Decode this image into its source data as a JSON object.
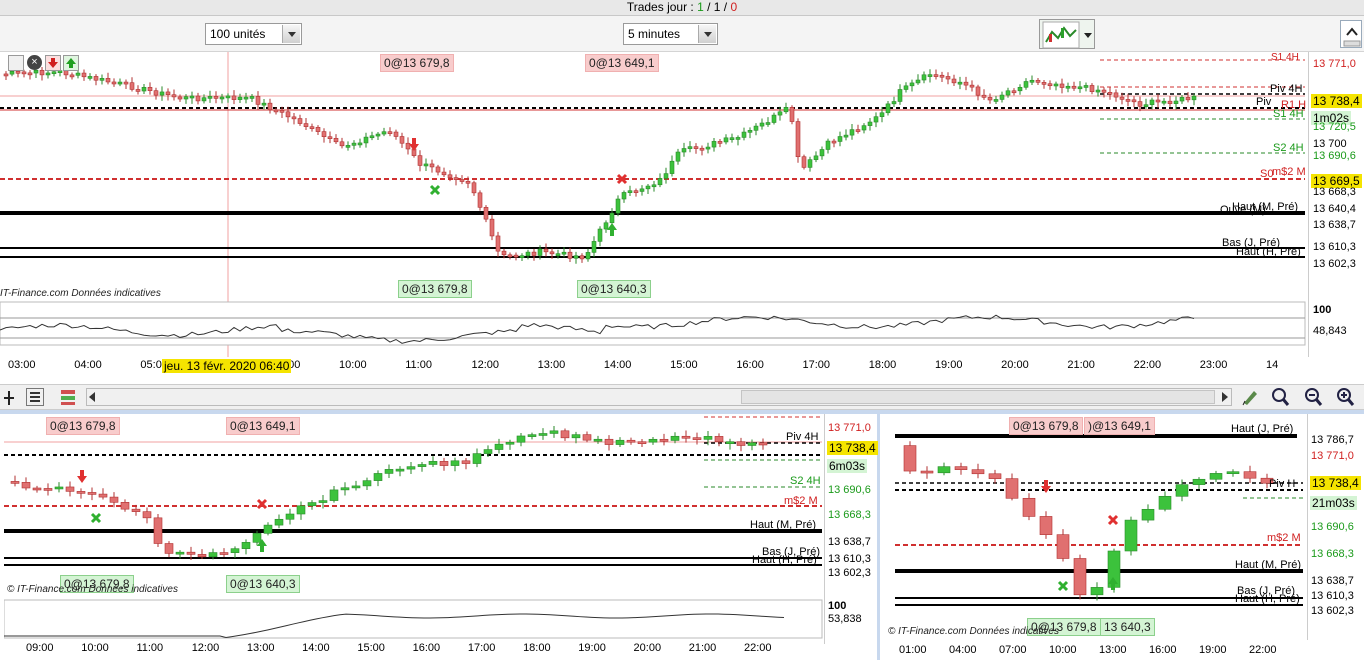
{
  "topbar": {
    "label": "Trades jour : ",
    "wins": "1",
    "sep1": " / ",
    "total": "1",
    "sep2": " / ",
    "losses": "0"
  },
  "toolbar": {
    "units_select": "100 unités",
    "interval_select": "5 minutes"
  },
  "main_chart": {
    "price_axis": [
      "13 771,0",
      "13 738,4",
      "1m02s",
      "13 720,5",
      "13 700",
      "13 690,6",
      "13 669,5",
      "13 668,3",
      "13 640,4",
      "13 638,7",
      "13 610,3",
      "13 602,3"
    ],
    "levels": [
      "S1 4H",
      "Piv 4H",
      "Piv",
      "R1 H",
      "S1 4H",
      "S2 4H",
      "S0",
      "m$2 M",
      "Haut (M, Pré)",
      "Ouve (M)",
      "Bas (J, Pré)",
      "Haut (H, Pré)"
    ],
    "orders": [
      "0@13 679,8",
      "0@13 649,1",
      "0@13 679,8",
      "0@13 640,3"
    ],
    "credit": "IT-Finance.com  Données indicatives",
    "osc_top": "100",
    "osc_value": "48,843",
    "time_ticks": [
      "03:00",
      "04:00",
      "05:00",
      "08:00",
      "09:00",
      "10:00",
      "11:00",
      "12:00",
      "13:00",
      "14:00",
      "15:00",
      "16:00",
      "17:00",
      "18:00",
      "19:00",
      "20:00",
      "21:00",
      "22:00",
      "23:00",
      "14"
    ],
    "crosshair_date": "jeu. 13 févr. 2020 06:40"
  },
  "bottom_left": {
    "price_axis": [
      "13 771,0",
      "13 738,4",
      "6m03s",
      "13 690,6",
      "13 668,3",
      "13 638,7",
      "13 610,3",
      "13 602,3"
    ],
    "levels": [
      "Piv 4H",
      "S2 4H",
      "m$2 M",
      "Haut (M, Pré)",
      "Bas (J, Pré)",
      "Haut (H, Pré)"
    ],
    "orders": [
      "0@13 679,8",
      "0@13 649,1",
      "0@13 679,8",
      "0@13 640,3"
    ],
    "credit": "© IT-Finance.com  Données indicatives",
    "osc_top": "100",
    "osc_value": "53,838",
    "time_ticks": [
      "09:00",
      "10:00",
      "11:00",
      "12:00",
      "13:00",
      "14:00",
      "15:00",
      "16:00",
      "17:00",
      "18:00",
      "19:00",
      "20:00",
      "21:00",
      "22:00"
    ]
  },
  "bottom_right": {
    "price_axis": [
      "13 786,7",
      "13 771,0",
      "13 738,4",
      "21m03s",
      "13 690,6",
      "13 668,3",
      "13 638,7",
      "13 610,3",
      "13 602,3"
    ],
    "levels": [
      "Haut (J, Pré)",
      "Piv H",
      "m$2 M",
      "Haut (M, Pré)",
      "Bas (J, Pré)",
      "Haut (H, Pré)"
    ],
    "orders": [
      "0@13 679,8",
      ")@13 649,1",
      "0@13 679,8",
      "13 640,3"
    ],
    "credit": "© IT-Finance.com  Données indicatives",
    "time_ticks": [
      "01:00",
      "04:00",
      "07:00",
      "10:00",
      "13:00",
      "16:00",
      "19:00",
      "22:00"
    ]
  },
  "colors": {
    "bull": "#3cc23c",
    "bear": "#e06464",
    "accent_yellow": "#f5e400",
    "axis_bg": "#ffffff"
  }
}
